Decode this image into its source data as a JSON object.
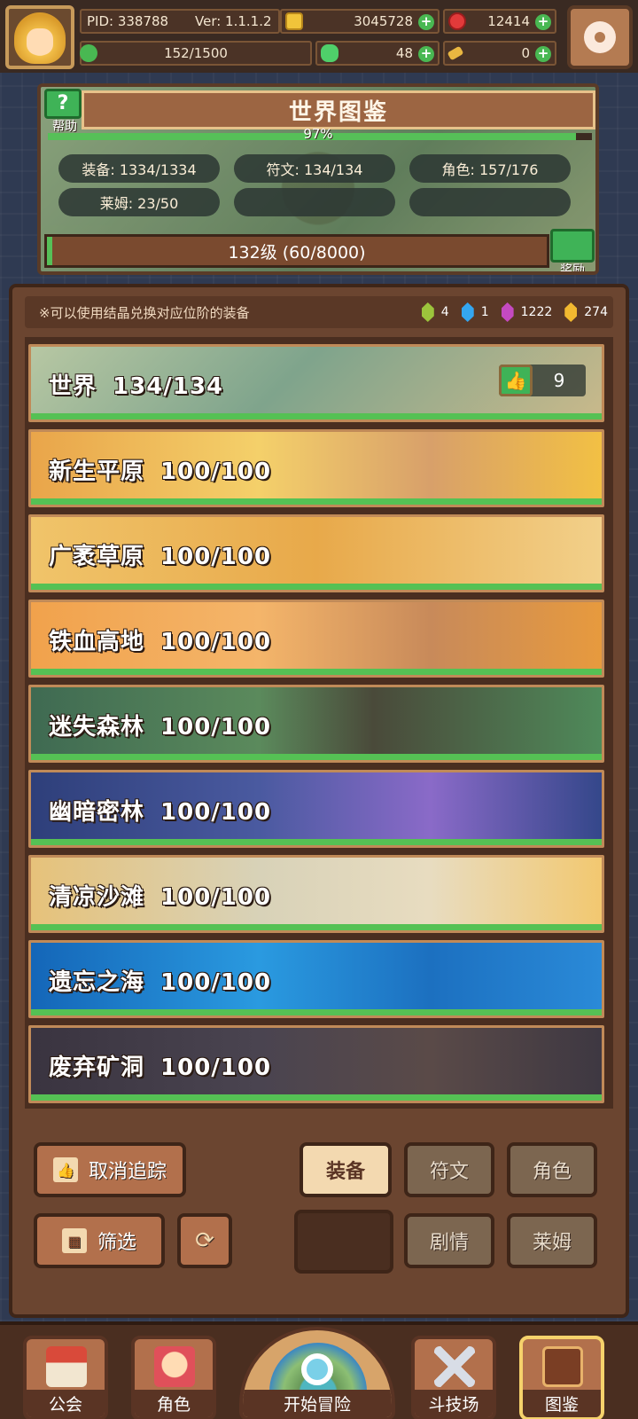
{
  "topbar": {
    "pid": "PID: 338788",
    "version": "Ver: 1.1.1.2",
    "gold": "3045728",
    "gems": "12414",
    "exp": "152/1500",
    "clover": "48",
    "keys": "0"
  },
  "encyclopedia": {
    "title": "世界图鉴",
    "help_label": "帮助",
    "progress_text": "97%",
    "progress_fraction": 0.97,
    "categories": [
      {
        "label": "装备: 1334/1334"
      },
      {
        "label": "符文: 134/134"
      },
      {
        "label": "角色: 157/176"
      },
      {
        "label": "莱姆: 23/50"
      },
      {
        "label": ""
      },
      {
        "label": ""
      }
    ],
    "level_text": "132级 (60/8000)",
    "level_fraction": 0.0075,
    "reward_label": "奖励"
  },
  "notice": {
    "text": "※可以使用结晶兑换对应位阶的装备",
    "crystals": [
      {
        "name": "green-crystal",
        "count": "4",
        "color": "#9cc43c"
      },
      {
        "name": "blue-crystal",
        "count": "1",
        "color": "#34a6f0"
      },
      {
        "name": "purple-crystal",
        "count": "1222",
        "color": "#c44ac0"
      },
      {
        "name": "gold-crystal",
        "count": "274",
        "color": "#f2b930"
      }
    ]
  },
  "regions": [
    {
      "name": "世界",
      "count": "134/134",
      "likes": "9",
      "bg": "map"
    },
    {
      "name": "新生平原",
      "count": "100/100",
      "bg": "autumn"
    },
    {
      "name": "广袤草原",
      "count": "100/100",
      "bg": "wheat"
    },
    {
      "name": "铁血高地",
      "count": "100/100",
      "bg": "highland"
    },
    {
      "name": "迷失森林",
      "count": "100/100",
      "bg": "forest"
    },
    {
      "name": "幽暗密林",
      "count": "100/100",
      "bg": "dark"
    },
    {
      "name": "清凉沙滩",
      "count": "100/100",
      "bg": "beach"
    },
    {
      "name": "遗忘之海",
      "count": "100/100",
      "bg": "sea"
    },
    {
      "name": "废弃矿洞",
      "count": "100/100",
      "bg": "mine"
    },
    {
      "name": "",
      "count": "",
      "bg": "cosmic"
    }
  ],
  "controls": {
    "untrack": "取消追踪",
    "filter": "筛选",
    "tabs": {
      "equipment": "装备",
      "runes": "符文",
      "characters": "角色",
      "story": "剧情",
      "slime": "莱姆"
    }
  },
  "nav": {
    "guild": "公会",
    "character": "角色",
    "start": "开始冒险",
    "arena": "斗技场",
    "codex": "图鉴"
  },
  "colors": {
    "accent_green": "#55c154",
    "panel_brown": "#6b4530",
    "active_tab": "#f3d9b0"
  }
}
